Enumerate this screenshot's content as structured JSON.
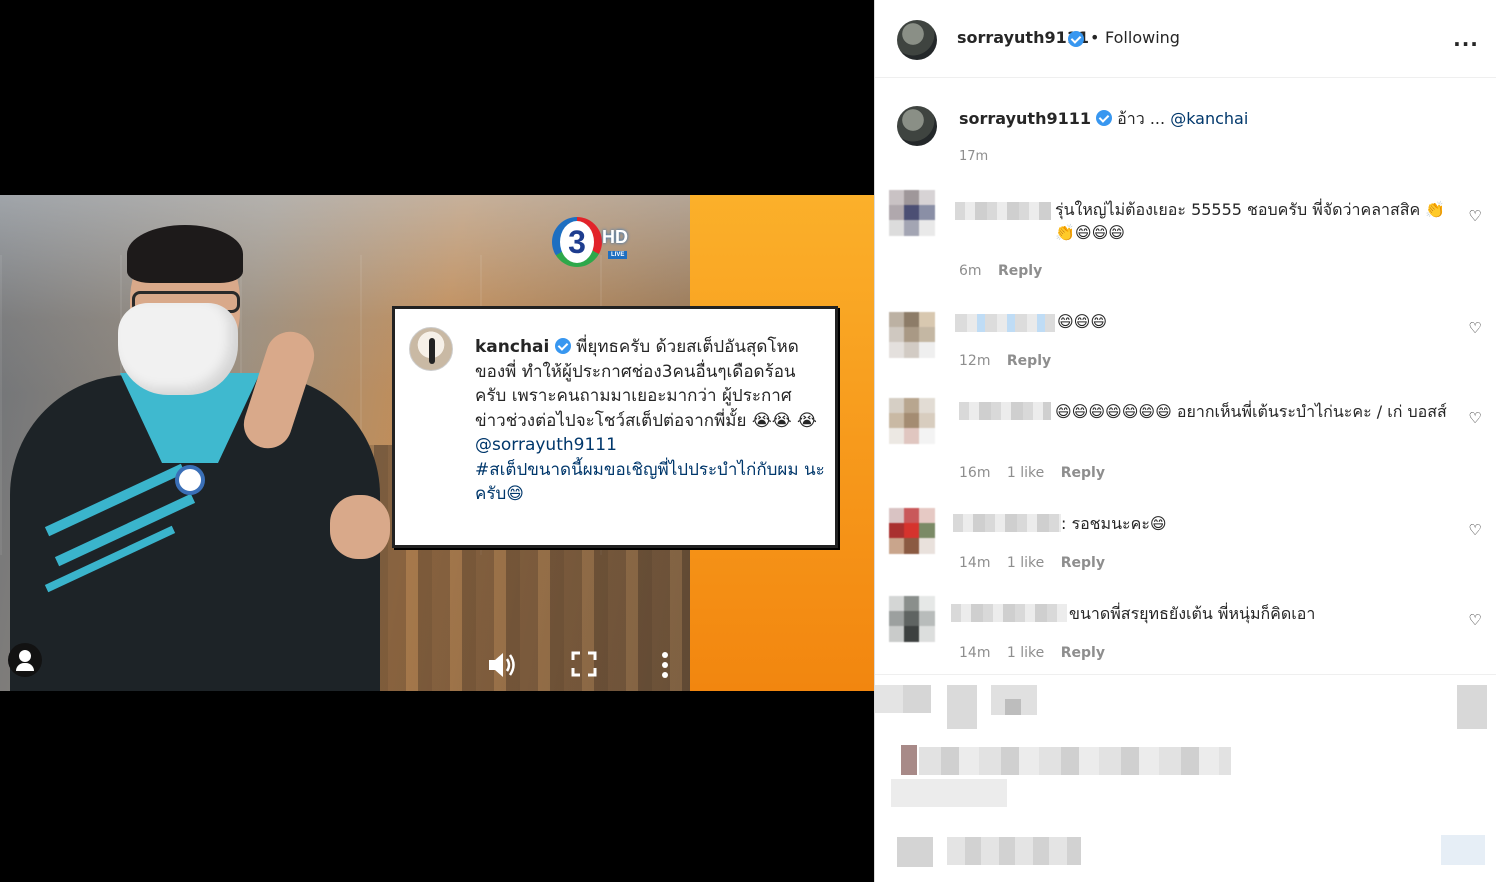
{
  "video": {
    "channel_logo_number": "3",
    "channel_logo_hd": "HD",
    "channel_logo_live": "LIVE",
    "quoted_post": {
      "username": "kanchai",
      "text": "พี่ยุทธครับ ด้วยสเต็ปอันสุดโหด ของพี่ ทำให้ผู้ประกาศช่อง3คนอื่นๆเดือดร้อน ครับ เพราะคนถามมาเยอะมากว่า ผู้ประกาศ ข่าวช่วงต่อไปจะโชว์สเต็ปต่อจากพี่มั้ย 😭😭 😭",
      "mention": "@sorrayuth9111",
      "hashtag": "#สเต็ปขนาดนี้ผมขอเชิญพี่ไปประบำไก่กับผม นะครับ😄"
    }
  },
  "header": {
    "username": "sorrayuth9111",
    "separator": "•",
    "follow_status": "Following",
    "more_glyph": "..."
  },
  "caption": {
    "username": "sorrayuth9111",
    "text": " อ้าว ... ",
    "mention": "@kanchai",
    "time": "17m"
  },
  "comments": [
    {
      "text": "รุ่นใหญ่ไม่ต้องเยอะ 55555 ชอบครับ พี่จัดว่าคลาสสิค 👏👏😄😄😄",
      "time": "6m",
      "likes": "",
      "reply": "Reply"
    },
    {
      "text": "😄😄😄",
      "time": "12m",
      "likes": "",
      "reply": "Reply"
    },
    {
      "text": "😄😄😄😄😄😄😄 อยากเห็นพี่เต้นระบำไก่นะคะ / เก่ บอสส์",
      "time": "16m",
      "likes": "1 like",
      "reply": "Reply"
    },
    {
      "text": ": รอชมนะคะ😄",
      "time": "14m",
      "likes": "1 like",
      "reply": "Reply"
    },
    {
      "text": "ขนาดพี่สรยุทธยังเต้น พี่หนุ่มก็คิดเอา",
      "time": "14m",
      "likes": "1 like",
      "reply": "Reply"
    }
  ],
  "colors": {
    "link": "#00376b",
    "verified": "#3897f0",
    "muted_text": "#8e8e8e",
    "primary_text": "#262626",
    "video_accent_orange": "#f79a1c",
    "jacket_stripe": "#3ab4cc"
  },
  "icons": {
    "user_tag": "person-icon",
    "sound": "speaker-icon",
    "fullscreen": "fullscreen-icon",
    "video_more": "vertical-dots-icon",
    "like": "heart-outline-icon",
    "verified": "verified-badge-icon"
  }
}
